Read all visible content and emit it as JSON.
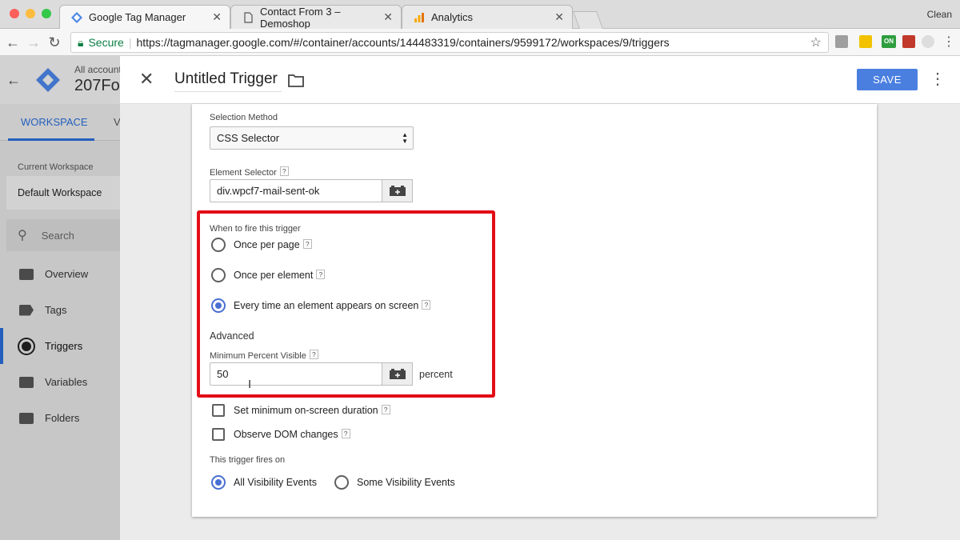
{
  "browser": {
    "tabs": [
      {
        "label": "Google Tag Manager",
        "active": true
      },
      {
        "label": "Contact From 3 – Demoshop",
        "active": false
      },
      {
        "label": "Analytics",
        "active": false
      }
    ],
    "profile": "Clean",
    "secure_label": "Secure",
    "url": "https://tagmanager.google.com/#/container/accounts/144483319/containers/9599172/workspaces/9/triggers",
    "extension_on_badge": "ON"
  },
  "gtm": {
    "account_label": "All account",
    "container_name": "207Fo",
    "workspace_tab": "WORKSPACE",
    "versions_tab_partial": "V",
    "current_workspace_label": "Current Workspace",
    "current_workspace_value": "Default Workspace",
    "search_placeholder": "Search",
    "nav": [
      {
        "label": "Overview",
        "icon": "overview-icon"
      },
      {
        "label": "Tags",
        "icon": "tag-icon"
      },
      {
        "label": "Triggers",
        "icon": "trigger-icon",
        "active": true
      },
      {
        "label": "Variables",
        "icon": "variable-icon"
      },
      {
        "label": "Folders",
        "icon": "folder-icon"
      }
    ],
    "accent_color": "#1a73e8"
  },
  "panel": {
    "title": "Untitled Trigger",
    "save_label": "SAVE",
    "selection_method_label": "Selection Method",
    "selection_method_value": "CSS Selector",
    "element_selector_label": "Element Selector",
    "element_selector_value": "div.wpcf7-mail-sent-ok",
    "when_to_fire_label": "When to fire this trigger",
    "fire_options": [
      {
        "label": "Once per page",
        "selected": false
      },
      {
        "label": "Once per element",
        "selected": false
      },
      {
        "label": "Every time an element appears on screen",
        "selected": true
      }
    ],
    "advanced_label": "Advanced",
    "min_percent_label": "Minimum Percent Visible",
    "min_percent_value": "50",
    "percent_suffix": "percent",
    "checkboxes": [
      {
        "label": "Set minimum on-screen duration",
        "checked": false
      },
      {
        "label": "Observe DOM changes",
        "checked": false
      }
    ],
    "fires_on_label": "This trigger fires on",
    "fires_on_options": [
      {
        "label": "All Visibility Events",
        "selected": true
      },
      {
        "label": "Some Visibility Events",
        "selected": false
      }
    ],
    "help_glyph": "?",
    "highlight_color": "#e30d17"
  }
}
